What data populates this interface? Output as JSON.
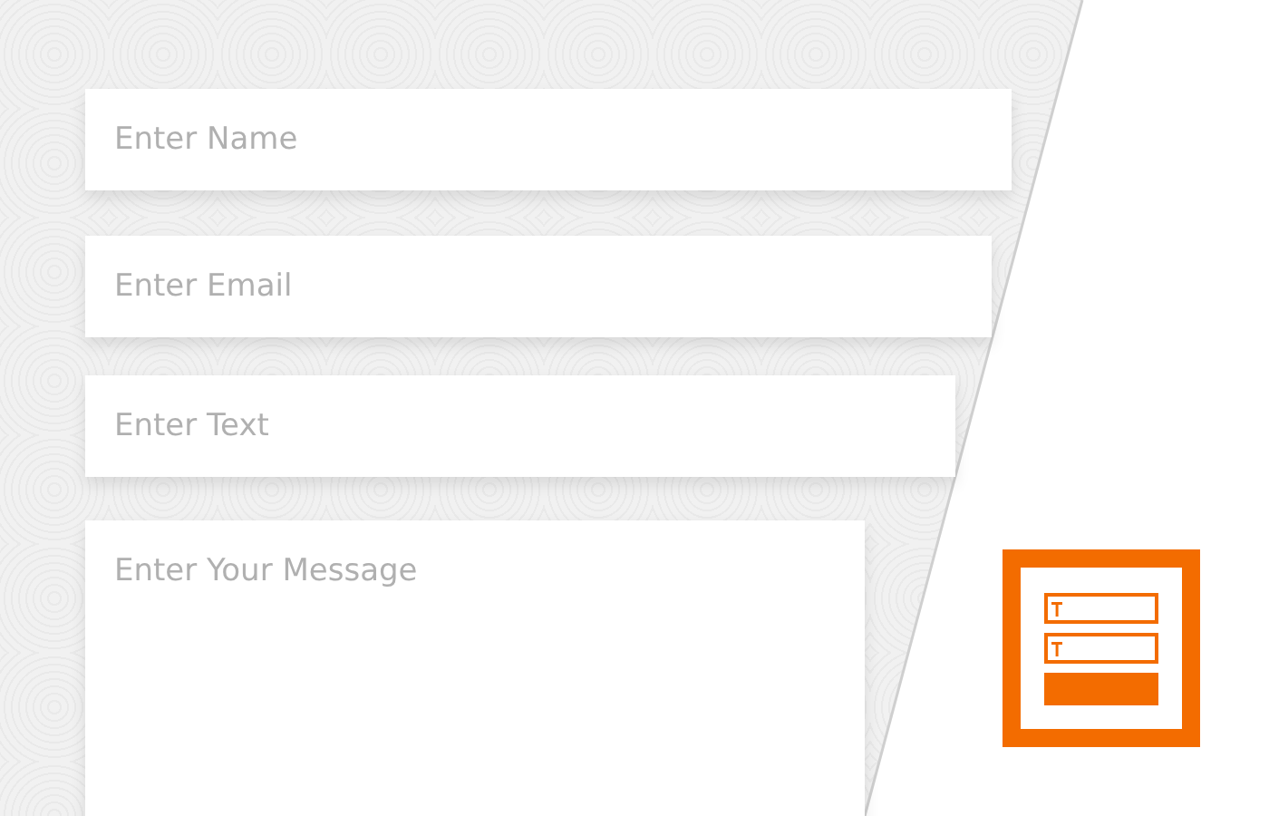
{
  "form": {
    "fields": [
      {
        "kind": "input",
        "placeholder": "Enter Name"
      },
      {
        "kind": "input",
        "placeholder": "Enter Email"
      },
      {
        "kind": "input",
        "placeholder": "Enter Text"
      },
      {
        "kind": "textarea",
        "placeholder": "Enter Your Message"
      }
    ]
  }
}
